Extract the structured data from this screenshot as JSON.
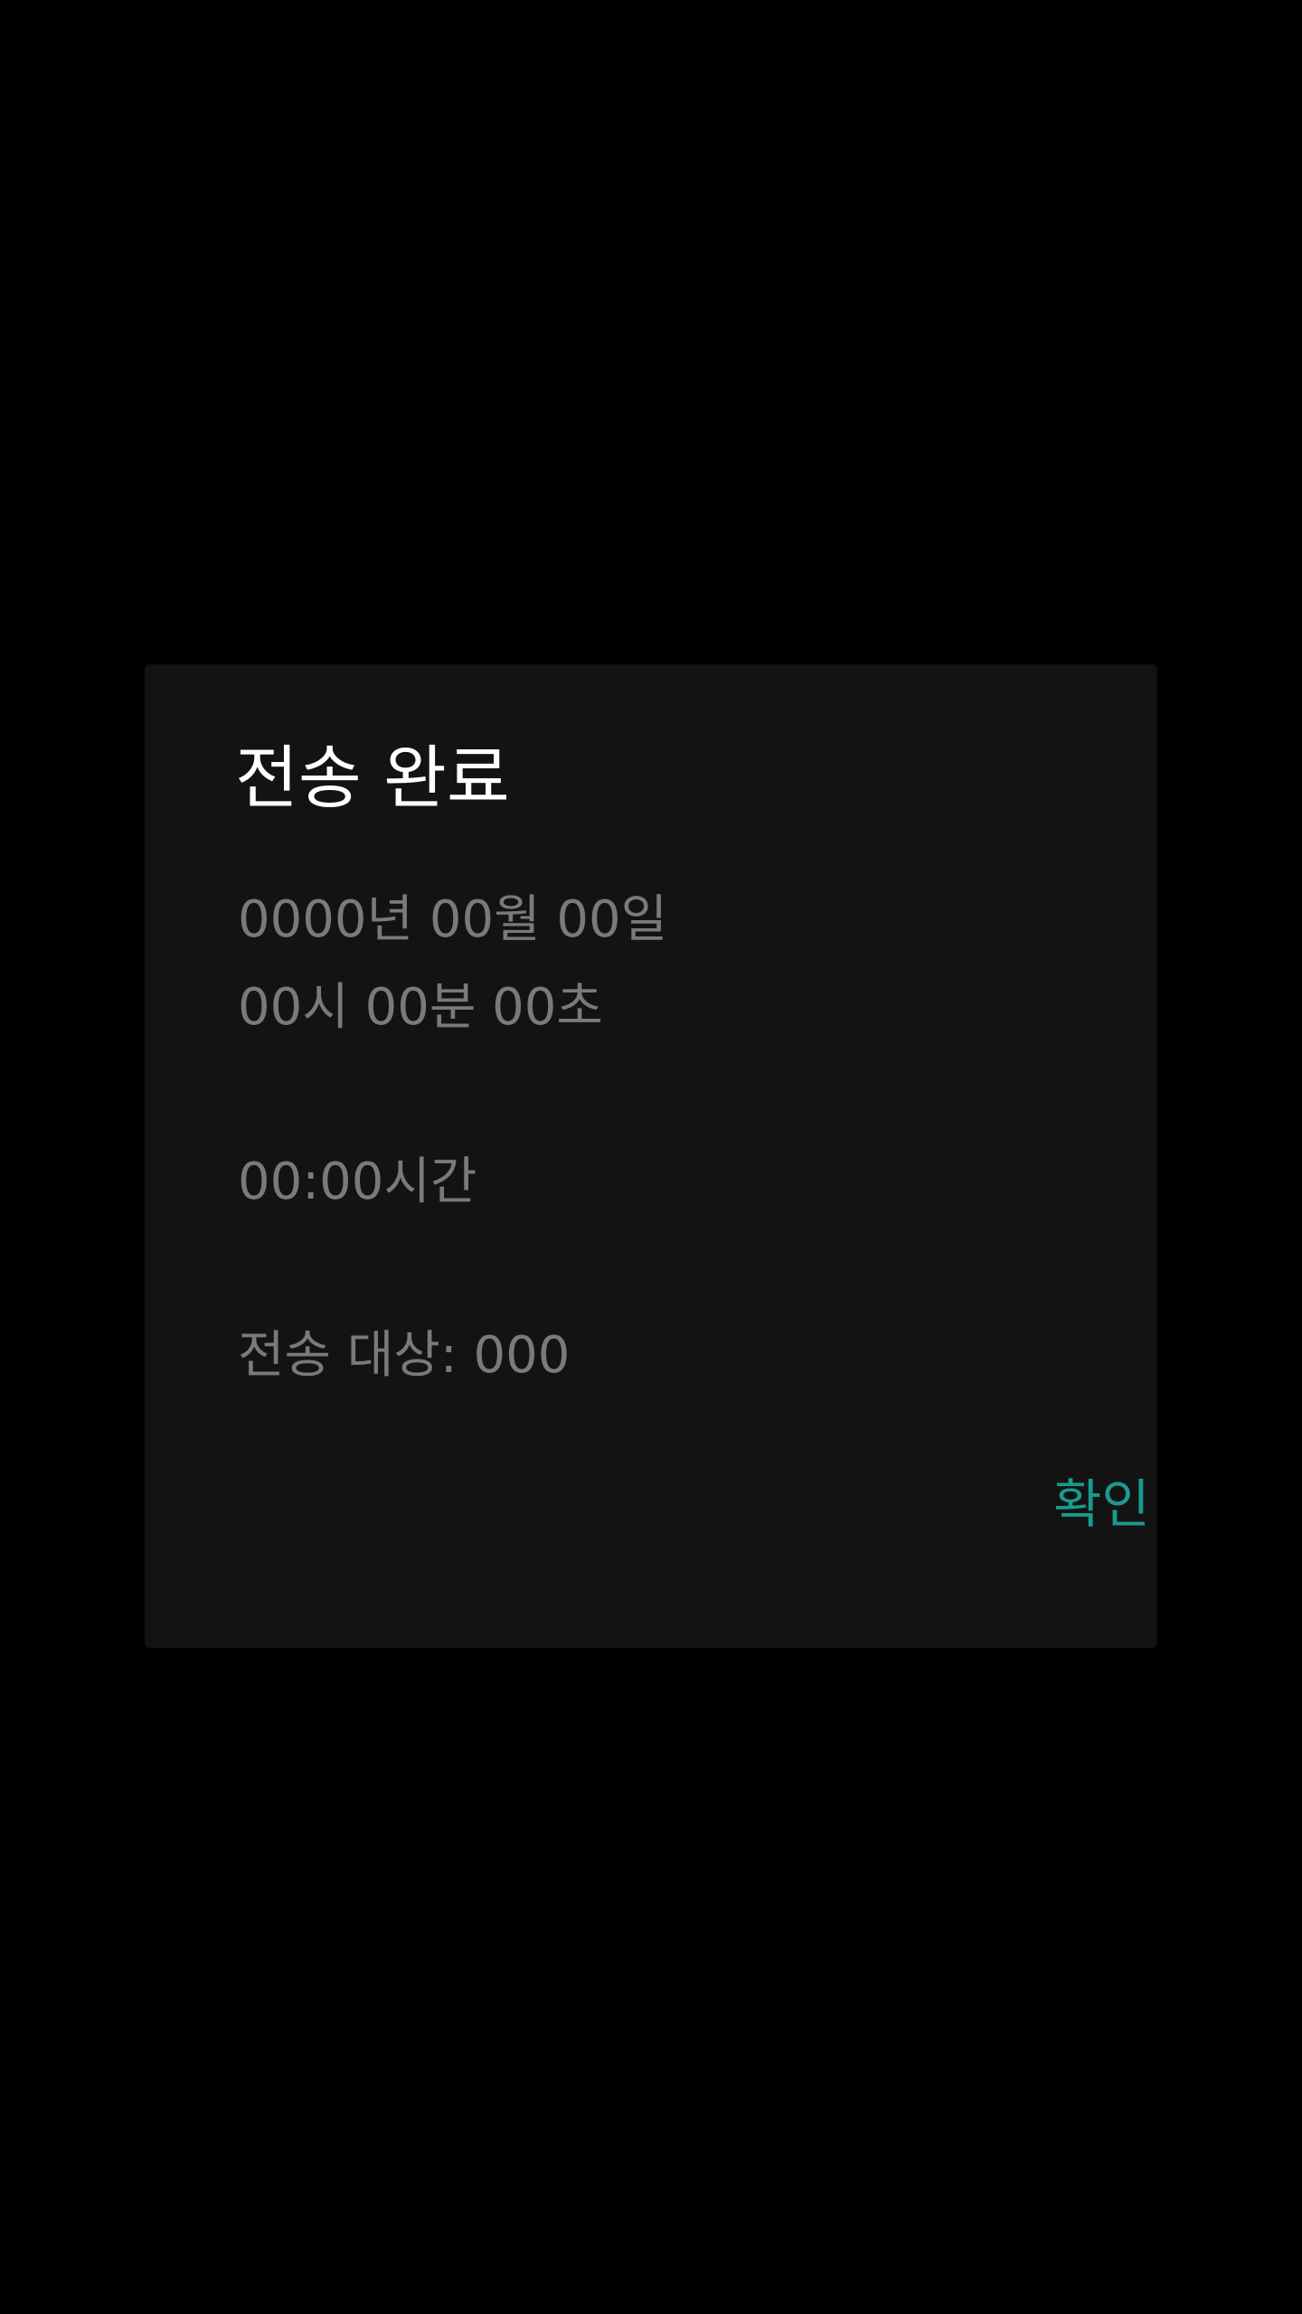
{
  "dialog": {
    "title": "전송 완료",
    "date": "0000년 00월 00일",
    "time": "00시 00분 00초",
    "duration": "00:00시간",
    "target": "전송 대상: 000",
    "confirm_label": "확인"
  },
  "colors": {
    "background": "#000000",
    "dialog": "#131313",
    "title": "#ffffff",
    "body_text": "#7a7a7a",
    "accent": "#1a9a8c"
  }
}
